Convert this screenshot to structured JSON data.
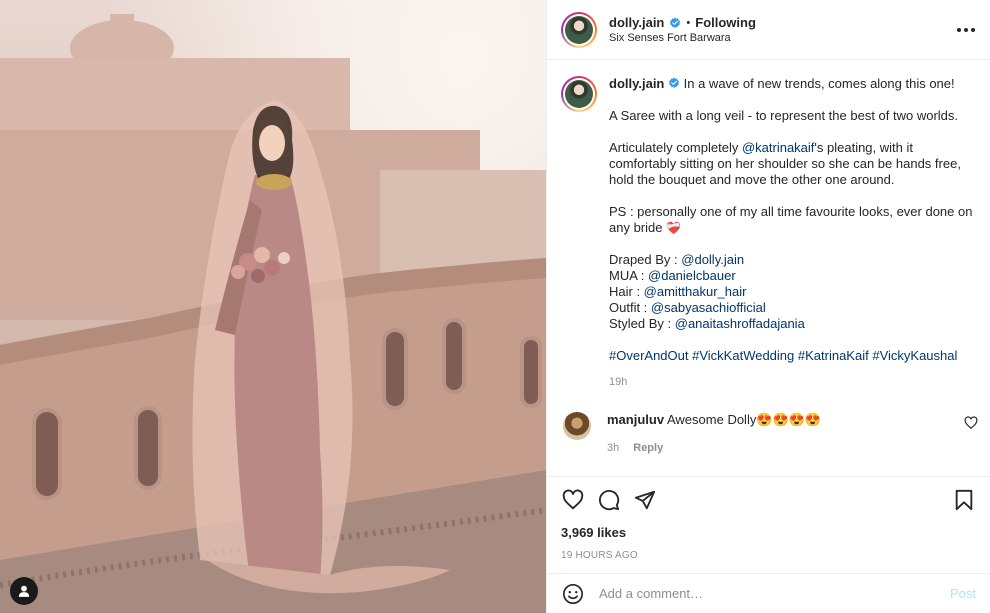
{
  "post": {
    "username": "dolly.jain",
    "follow_status": "Following",
    "location": "Six Senses Fort Barwara",
    "caption": {
      "intro": "In a wave of new trends, comes along this one!",
      "p2": "A Saree with a long veil - to represent the best of two worlds.",
      "p3_before": "Articulately completely ",
      "p3_mention": "@katrinakaif",
      "p3_after": "'s pleating, with it comfortably sitting on her shoulder so she can be hands free, hold the bouquet and move the other one around.",
      "p4": "PS : personally one of my all time favourite looks, ever done on any bride",
      "p4_emoji": "❤️‍🩹",
      "credits": [
        {
          "label": "Draped By : ",
          "handle": "@dolly.jain"
        },
        {
          "label": "MUA : ",
          "handle": "@danielcbauer"
        },
        {
          "label": "Hair : ",
          "handle": "@amitthakur_hair"
        },
        {
          "label": "Outfit : ",
          "handle": "@sabyasachiofficial"
        },
        {
          "label": "Styled By : ",
          "handle": "@anaitashroffadajania"
        }
      ],
      "hashtags": [
        "#OverAndOut",
        "#VickKatWedding",
        "#KatrinaKaif",
        "#VickyKaushal"
      ],
      "time": "19h"
    },
    "comments": [
      {
        "username": "manjuluv",
        "text": "Awesome Dolly😍😍😍😍",
        "time": "3h",
        "reply_label": "Reply"
      }
    ],
    "likes": "3,969 likes",
    "posted": "19 HOURS AGO"
  },
  "composer": {
    "placeholder": "Add a comment…",
    "post_label": "Post"
  },
  "icons": {
    "verified": "verified-badge-icon",
    "more": "more-options-icon",
    "like": "heart-icon",
    "comment": "comment-bubble-icon",
    "share": "paper-plane-icon",
    "save": "bookmark-icon",
    "emoji": "smiley-icon",
    "tagged_people": "person-icon"
  },
  "colors": {
    "link": "#00376b",
    "verified": "#3897f0",
    "muted": "#8e8e8e",
    "post_disabled": "#b2dffc"
  }
}
